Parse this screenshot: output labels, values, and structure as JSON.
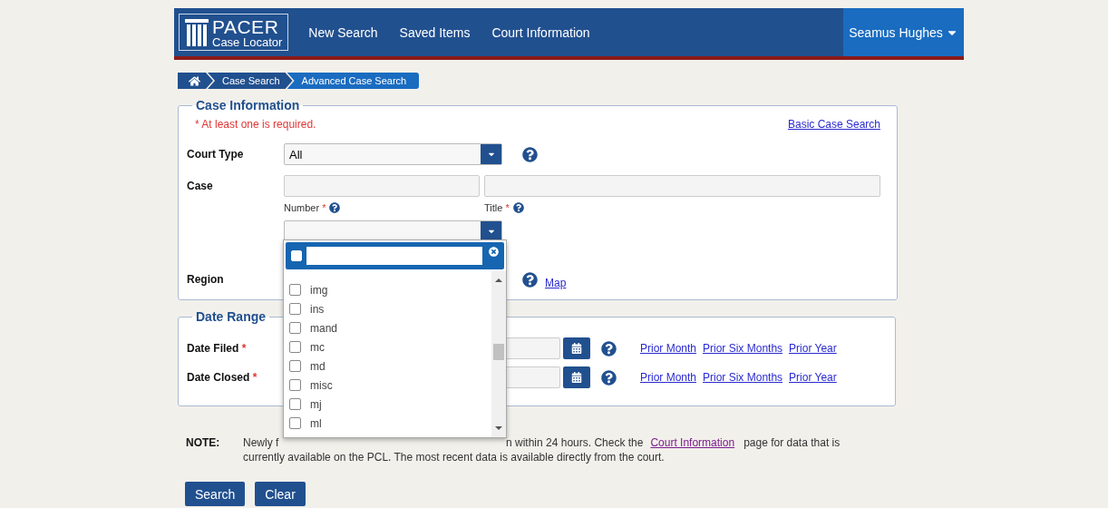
{
  "header": {
    "logo": {
      "title": "PACER",
      "subtitle": "Case Locator"
    },
    "nav": [
      "New Search",
      "Saved Items",
      "Court Information"
    ],
    "user": "Seamus Hughes"
  },
  "breadcrumb": [
    {
      "label": "Case Search",
      "selected": false
    },
    {
      "label": "Advanced Case Search",
      "selected": true
    }
  ],
  "case_information": {
    "legend": "Case Information",
    "required_note": "* At least one is required.",
    "basic_link": "Basic Case Search",
    "court_type": {
      "label": "Court Type",
      "value": "All"
    },
    "case": {
      "label": "Case",
      "sublabels": [
        {
          "text": "Number",
          "mark": "*"
        },
        {
          "text": "Title",
          "mark": "*"
        }
      ]
    },
    "region": {
      "label": "Region",
      "map_link": "Map"
    }
  },
  "dropdown": {
    "select_all_checked": false,
    "items": [
      {
        "label": "img",
        "checked": false
      },
      {
        "label": "ins",
        "checked": false
      },
      {
        "label": "mand",
        "checked": false
      },
      {
        "label": "mc",
        "checked": false
      },
      {
        "label": "md",
        "checked": false
      },
      {
        "label": "misc",
        "checked": false
      },
      {
        "label": "mj",
        "checked": false
      },
      {
        "label": "ml",
        "checked": false
      }
    ]
  },
  "date_range": {
    "legend": "Date Range",
    "rows": [
      {
        "label": "Date Filed",
        "mark": "*",
        "links": [
          "Prior Month",
          "Prior Six Months",
          "Prior Year"
        ]
      },
      {
        "label": "Date Closed",
        "mark": "*",
        "links": [
          "Prior Month",
          "Prior Six Months",
          "Prior Year"
        ]
      }
    ]
  },
  "note": {
    "label": "NOTE:",
    "line1_start": "Newly f",
    "line1_end": "n within 24 hours. Check the",
    "link": "Court Information",
    "line1_after": "page for data that is",
    "line2": "currently available on the PCL. The most recent data is available directly from the court."
  },
  "buttons": [
    "Search",
    "Clear"
  ]
}
